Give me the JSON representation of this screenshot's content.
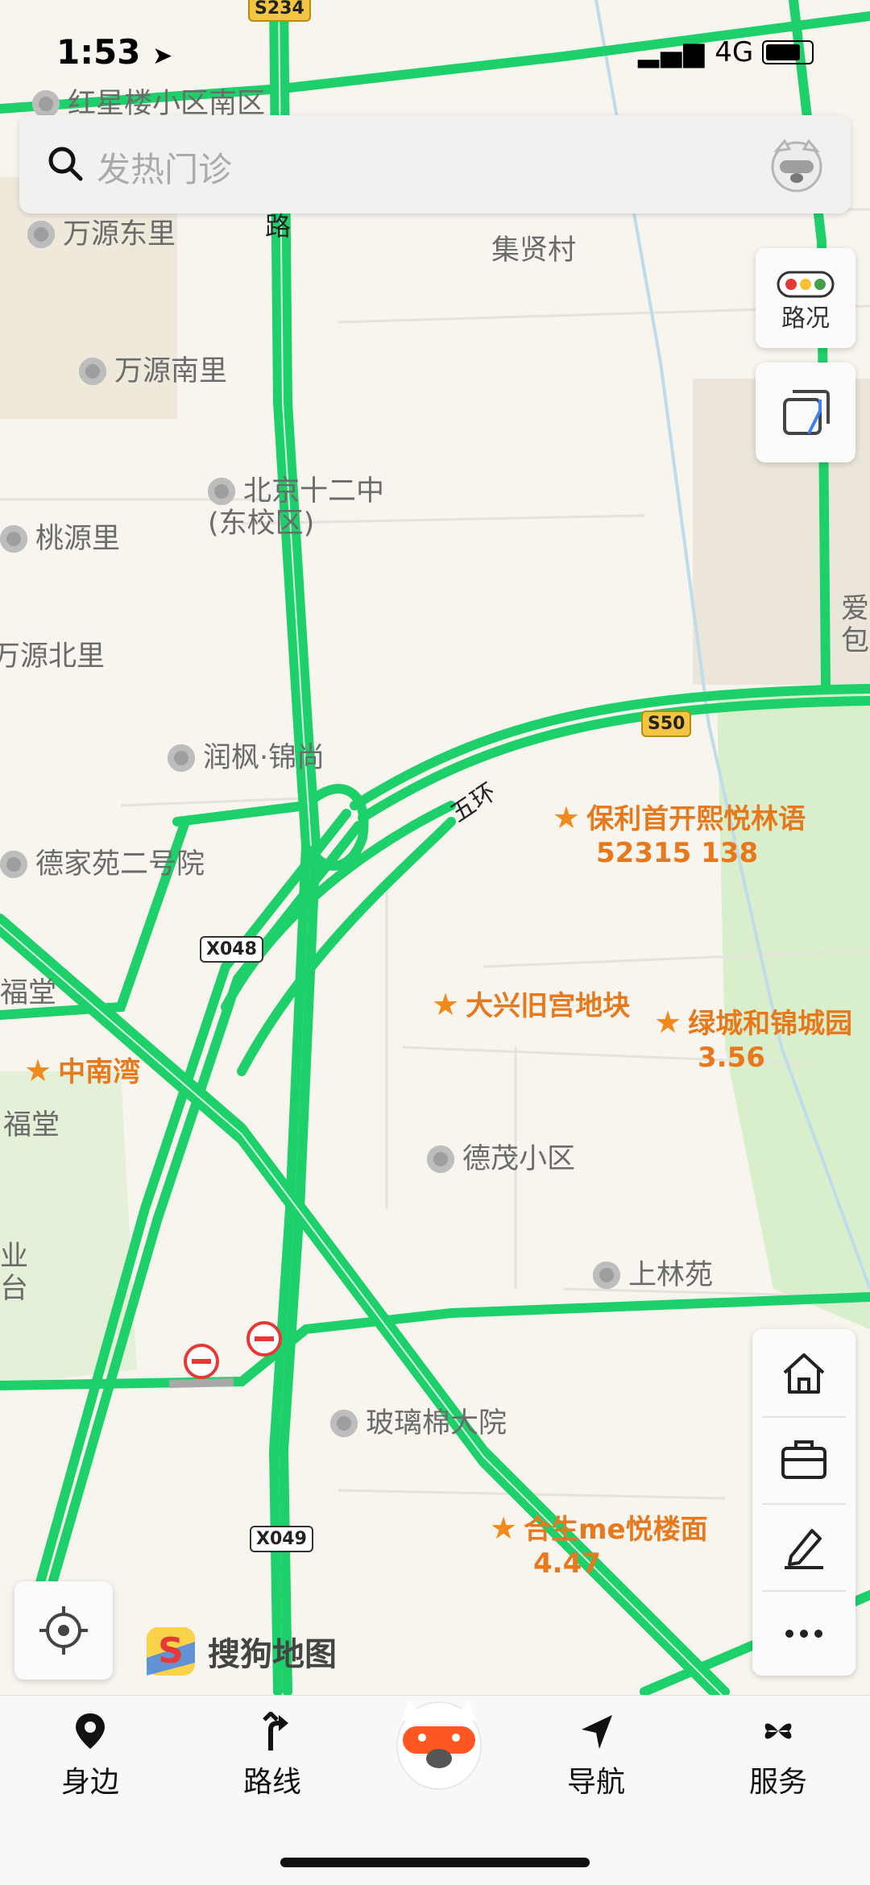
{
  "status_bar": {
    "time": "1:53",
    "network": "4G"
  },
  "search": {
    "placeholder": "发热门诊"
  },
  "right_controls": {
    "traffic_label": "路况",
    "layers_label": ""
  },
  "map_labels": [
    {
      "text": "红星楼小区南区",
      "type": "grey"
    },
    {
      "text": "万源东里",
      "type": "grey"
    },
    {
      "text": "集贤村",
      "type": "plain"
    },
    {
      "text": "万源南里",
      "type": "grey"
    },
    {
      "text": "北京十二中\n(东校区)",
      "type": "school"
    },
    {
      "text": "桃源里",
      "type": "grey"
    },
    {
      "text": "万源北里",
      "type": "plain"
    },
    {
      "text": "润枫·锦尚",
      "type": "grey"
    },
    {
      "text": "德家苑二号院",
      "type": "grey"
    },
    {
      "text": "福堂",
      "type": "plain"
    },
    {
      "text": "福堂",
      "type": "plain"
    },
    {
      "text": "德茂小区",
      "type": "grey"
    },
    {
      "text": "上林苑",
      "type": "grey"
    },
    {
      "text": "玻璃棉大院",
      "type": "grey"
    },
    {
      "text": "五环",
      "type": "road"
    },
    {
      "text": "爱\n包",
      "type": "plain"
    },
    {
      "text": "业\n台",
      "type": "plain"
    },
    {
      "text": "兴贤路",
      "type": "road"
    }
  ],
  "orange_pois": [
    {
      "name": "保利首开熙悦林语",
      "sub": "52315 138"
    },
    {
      "name": "大兴旧宫地块",
      "sub": ""
    },
    {
      "name": "绿城和锦城园",
      "sub": "3.56"
    },
    {
      "name": "中南湾",
      "sub": ""
    },
    {
      "name": "合生me悦楼面",
      "sub": "4.47"
    }
  ],
  "road_shields": [
    {
      "text": "S234",
      "kind": "yellow"
    },
    {
      "text": "S50",
      "kind": "yellow"
    },
    {
      "text": "X048",
      "kind": "white"
    },
    {
      "text": "X049",
      "kind": "white"
    }
  ],
  "brand": {
    "name": "搜狗地图"
  },
  "tools": [
    {
      "icon": "home-icon"
    },
    {
      "icon": "briefcase-icon"
    },
    {
      "icon": "edit-icon"
    },
    {
      "icon": "more-icon"
    }
  ],
  "tabbar": {
    "tabs": [
      {
        "label": "身边",
        "icon": "pin-icon"
      },
      {
        "label": "路线",
        "icon": "route-icon"
      },
      {
        "label": "导航",
        "icon": "navigate-icon"
      },
      {
        "label": "服务",
        "icon": "services-icon"
      }
    ]
  },
  "colors": {
    "road_green": "#1ed06a",
    "poi_orange": "#e8781c",
    "map_bg": "#f7f5ee"
  }
}
